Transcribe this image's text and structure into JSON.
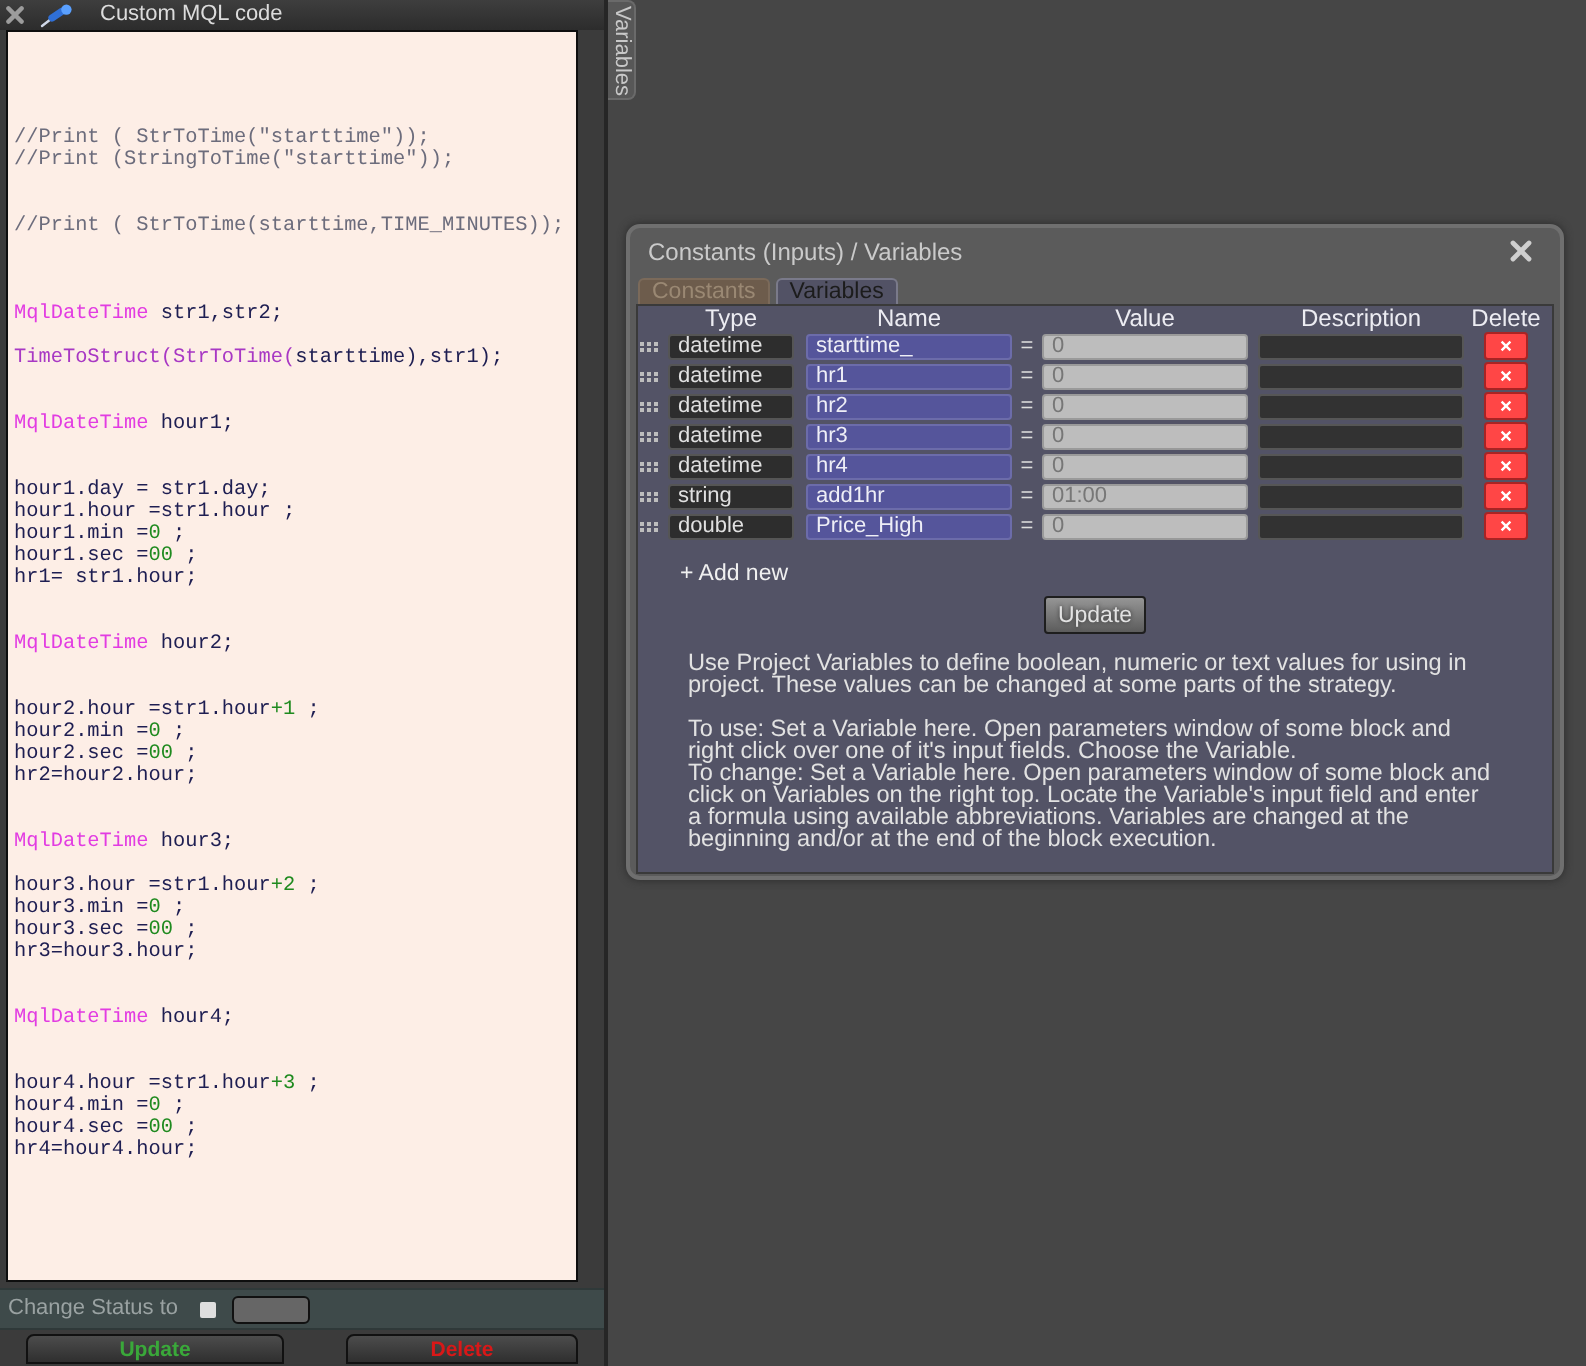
{
  "editor_panel": {
    "title": "Custom MQL code",
    "code_lines": [
      {
        "kind": "blank"
      },
      {
        "kind": "blank"
      },
      {
        "kind": "blank"
      },
      {
        "kind": "blank"
      },
      {
        "kind": "code",
        "tokens": [
          {
            "kind": "comment",
            "text": "//Print ( StrToTime(\"starttime\"));"
          }
        ]
      },
      {
        "kind": "code",
        "tokens": [
          {
            "kind": "comment",
            "text": "//Print (StringToTime(\"starttime\"));"
          }
        ]
      },
      {
        "kind": "blank"
      },
      {
        "kind": "blank"
      },
      {
        "kind": "code",
        "tokens": [
          {
            "kind": "comment",
            "text": "//Print ( StrToTime(starttime,TIME_MINUTES));"
          }
        ]
      },
      {
        "kind": "blank"
      },
      {
        "kind": "blank"
      },
      {
        "kind": "blank"
      },
      {
        "kind": "code",
        "tokens": [
          {
            "kind": "type",
            "text": "MqlDateTime"
          },
          {
            "kind": "text",
            "text": " str1,str2;"
          }
        ]
      },
      {
        "kind": "blank"
      },
      {
        "kind": "code",
        "tokens": [
          {
            "kind": "function",
            "text": "TimeToStruct(StrToTime("
          },
          {
            "kind": "text",
            "text": "starttime),str1);"
          }
        ]
      },
      {
        "kind": "blank"
      },
      {
        "kind": "blank"
      },
      {
        "kind": "code",
        "tokens": [
          {
            "kind": "type",
            "text": "MqlDateTime"
          },
          {
            "kind": "text",
            "text": " hour1;"
          }
        ]
      },
      {
        "kind": "blank"
      },
      {
        "kind": "blank"
      },
      {
        "kind": "code",
        "tokens": [
          {
            "kind": "text",
            "text": "hour1.day = str1.day;"
          }
        ]
      },
      {
        "kind": "code",
        "tokens": [
          {
            "kind": "text",
            "text": "hour1.hour =str1.hour ;"
          }
        ]
      },
      {
        "kind": "code",
        "tokens": [
          {
            "kind": "text",
            "text": "hour1.min ="
          },
          {
            "kind": "number",
            "text": "0"
          },
          {
            "kind": "text",
            "text": " ;"
          }
        ]
      },
      {
        "kind": "code",
        "tokens": [
          {
            "kind": "text",
            "text": "hour1.sec ="
          },
          {
            "kind": "number",
            "text": "00"
          },
          {
            "kind": "text",
            "text": " ;"
          }
        ]
      },
      {
        "kind": "code",
        "tokens": [
          {
            "kind": "text",
            "text": "hr1= str1.hour;"
          }
        ]
      },
      {
        "kind": "blank"
      },
      {
        "kind": "blank"
      },
      {
        "kind": "code",
        "tokens": [
          {
            "kind": "type",
            "text": "MqlDateTime"
          },
          {
            "kind": "text",
            "text": " hour2;"
          }
        ]
      },
      {
        "kind": "blank"
      },
      {
        "kind": "blank"
      },
      {
        "kind": "code",
        "tokens": [
          {
            "kind": "text",
            "text": "hour2.hour =str1.hour"
          },
          {
            "kind": "number",
            "text": "+1"
          },
          {
            "kind": "text",
            "text": " ;"
          }
        ]
      },
      {
        "kind": "code",
        "tokens": [
          {
            "kind": "text",
            "text": "hour2.min ="
          },
          {
            "kind": "number",
            "text": "0"
          },
          {
            "kind": "text",
            "text": " ;"
          }
        ]
      },
      {
        "kind": "code",
        "tokens": [
          {
            "kind": "text",
            "text": "hour2.sec ="
          },
          {
            "kind": "number",
            "text": "00"
          },
          {
            "kind": "text",
            "text": " ;"
          }
        ]
      },
      {
        "kind": "code",
        "tokens": [
          {
            "kind": "text",
            "text": "hr2=hour2.hour;"
          }
        ]
      },
      {
        "kind": "blank"
      },
      {
        "kind": "blank"
      },
      {
        "kind": "code",
        "tokens": [
          {
            "kind": "type",
            "text": "MqlDateTime"
          },
          {
            "kind": "text",
            "text": " hour3;"
          }
        ]
      },
      {
        "kind": "blank"
      },
      {
        "kind": "code",
        "tokens": [
          {
            "kind": "text",
            "text": "hour3.hour =str1.hour"
          },
          {
            "kind": "number",
            "text": "+2"
          },
          {
            "kind": "text",
            "text": " ;"
          }
        ]
      },
      {
        "kind": "code",
        "tokens": [
          {
            "kind": "text",
            "text": "hour3.min ="
          },
          {
            "kind": "number",
            "text": "0"
          },
          {
            "kind": "text",
            "text": " ;"
          }
        ]
      },
      {
        "kind": "code",
        "tokens": [
          {
            "kind": "text",
            "text": "hour3.sec ="
          },
          {
            "kind": "number",
            "text": "00"
          },
          {
            "kind": "text",
            "text": " ;"
          }
        ]
      },
      {
        "kind": "code",
        "tokens": [
          {
            "kind": "text",
            "text": "hr3=hour3.hour;"
          }
        ]
      },
      {
        "kind": "blank"
      },
      {
        "kind": "blank"
      },
      {
        "kind": "code",
        "tokens": [
          {
            "kind": "type",
            "text": "MqlDateTime"
          },
          {
            "kind": "text",
            "text": " hour4;"
          }
        ]
      },
      {
        "kind": "blank"
      },
      {
        "kind": "blank"
      },
      {
        "kind": "code",
        "tokens": [
          {
            "kind": "text",
            "text": "hour4.hour =str1.hour"
          },
          {
            "kind": "number",
            "text": "+3"
          },
          {
            "kind": "text",
            "text": " ;"
          }
        ]
      },
      {
        "kind": "code",
        "tokens": [
          {
            "kind": "text",
            "text": "hour4.min ="
          },
          {
            "kind": "number",
            "text": "0"
          },
          {
            "kind": "text",
            "text": " ;"
          }
        ]
      },
      {
        "kind": "code",
        "tokens": [
          {
            "kind": "text",
            "text": "hour4.sec ="
          },
          {
            "kind": "number",
            "text": "00"
          },
          {
            "kind": "text",
            "text": " ;"
          }
        ]
      },
      {
        "kind": "code",
        "tokens": [
          {
            "kind": "text",
            "text": "hr4=hour4.hour;"
          }
        ]
      }
    ],
    "status_label": "Change Status to",
    "status_checkbox": {
      "checked": false
    },
    "buttons": [
      {
        "label": "Update",
        "kind": "update"
      },
      {
        "label": "Delete",
        "kind": "delete"
      }
    ]
  },
  "side_tab": {
    "label": "Variables"
  },
  "dialog": {
    "title": "Constants (Inputs) / Variables",
    "tabs": [
      {
        "label": "Constants",
        "selected": false
      },
      {
        "label": "Variables",
        "selected": true
      }
    ],
    "columns": [
      "Type",
      "Name",
      "Value",
      "Description",
      "Delete"
    ],
    "rows": [
      {
        "type": "datetime",
        "name": "starttime_",
        "equals": "=",
        "value": "0"
      },
      {
        "type": "datetime",
        "name": "hr1",
        "equals": "=",
        "value": "0"
      },
      {
        "type": "datetime",
        "name": "hr2",
        "equals": "=",
        "value": "0"
      },
      {
        "type": "datetime",
        "name": "hr3",
        "equals": "=",
        "value": "0"
      },
      {
        "type": "datetime",
        "name": "hr4",
        "equals": "=",
        "value": "0"
      },
      {
        "type": "string",
        "name": "add1hr",
        "equals": "=",
        "value": "01:00"
      },
      {
        "type": "double",
        "name": "Price_High",
        "equals": "=",
        "value": "0"
      }
    ],
    "add_link": "+ Add new",
    "update_button": "Update",
    "help_sections": [
      {
        "paragraphs": [
          "Use Project Variables to define boolean, numeric or text values for using in project. These values can be changed at some parts of the strategy."
        ]
      },
      {
        "paragraphs": [
          "To use: Set a Variable here. Open parameters window of some block and right click over one of it's input fields. Choose the Variable.",
          "To change: Set a Variable here. Open parameters window of some block and click on Variables on the right top. Locate the Variable's input field and enter a formula using available abbreviations. Variables are changed at the beginning and/or at the end of the block execution."
        ]
      }
    ]
  }
}
